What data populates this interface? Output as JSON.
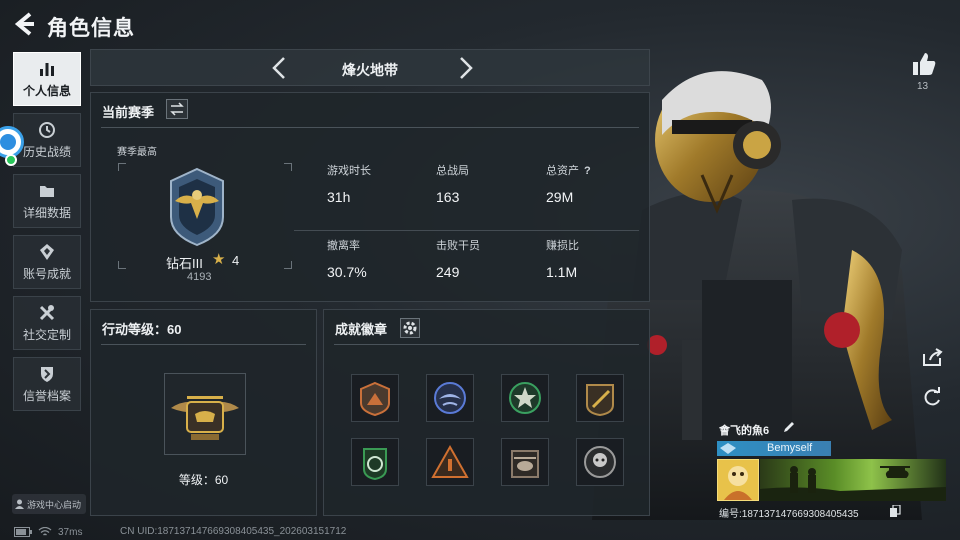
{
  "header": {
    "title": "角色信息"
  },
  "sidebar": {
    "items": [
      {
        "label": "个人信息",
        "icon": "bar-chart-icon",
        "active": true
      },
      {
        "label": "历史战绩",
        "icon": "clock-icon",
        "active": false
      },
      {
        "label": "详细数据",
        "icon": "folder-icon",
        "active": false
      },
      {
        "label": "账号成就",
        "icon": "medal-icon",
        "active": false
      },
      {
        "label": "社交定制",
        "icon": "tools-icon",
        "active": false
      },
      {
        "label": "信誉档案",
        "icon": "shield-icon",
        "active": false
      }
    ],
    "game_center_label": "游戏中心启动"
  },
  "map": {
    "name": "烽火地带"
  },
  "season": {
    "title": "当前赛季",
    "best_label": "赛季最高",
    "rank_name": "钻石III",
    "rank_stars": "4",
    "rank_points": "4193",
    "stats": [
      {
        "label": "游戏时长",
        "value": "31h"
      },
      {
        "label": "总战局",
        "value": "163"
      },
      {
        "label": "总资产",
        "value": "29M",
        "help": "?"
      },
      {
        "label": "撤离率",
        "value": "30.7%"
      },
      {
        "label": "击败干员",
        "value": "249"
      },
      {
        "label": "赚损比",
        "value": "1.1M"
      }
    ]
  },
  "action_level": {
    "title": "行动等级：60",
    "level_text": "等级：60"
  },
  "achievements": {
    "title": "成就徽章",
    "badges": [
      {
        "icon": "mountain-badge-icon",
        "color": "#c9703a"
      },
      {
        "icon": "eagle-badge-icon",
        "color": "#5a7ad6"
      },
      {
        "icon": "star-badge-icon",
        "color": "#3aa060"
      },
      {
        "icon": "sword-badge-icon",
        "color": "#b08a4a"
      },
      {
        "icon": "leaf-badge-icon",
        "color": "#3a9a54"
      },
      {
        "icon": "triangle-badge-icon",
        "color": "#d07030"
      },
      {
        "icon": "helicopter-badge-icon",
        "color": "#8a7a6a"
      },
      {
        "icon": "skull-badge-icon",
        "color": "#9a9a9a"
      }
    ]
  },
  "social": {
    "like_count": "13"
  },
  "player_card": {
    "name": "會飞的魚6",
    "tag": "Bemyself",
    "id_line": "编号:18713714766930840543​5"
  },
  "status": {
    "ping": "37ms",
    "uid_line": "CN UID:18713714766930840543​5_202603151712"
  },
  "colors": {
    "accent_gold": "#d8b04a",
    "panel_bg": "#1f252a",
    "tag_blue": "#2e8fc3"
  }
}
